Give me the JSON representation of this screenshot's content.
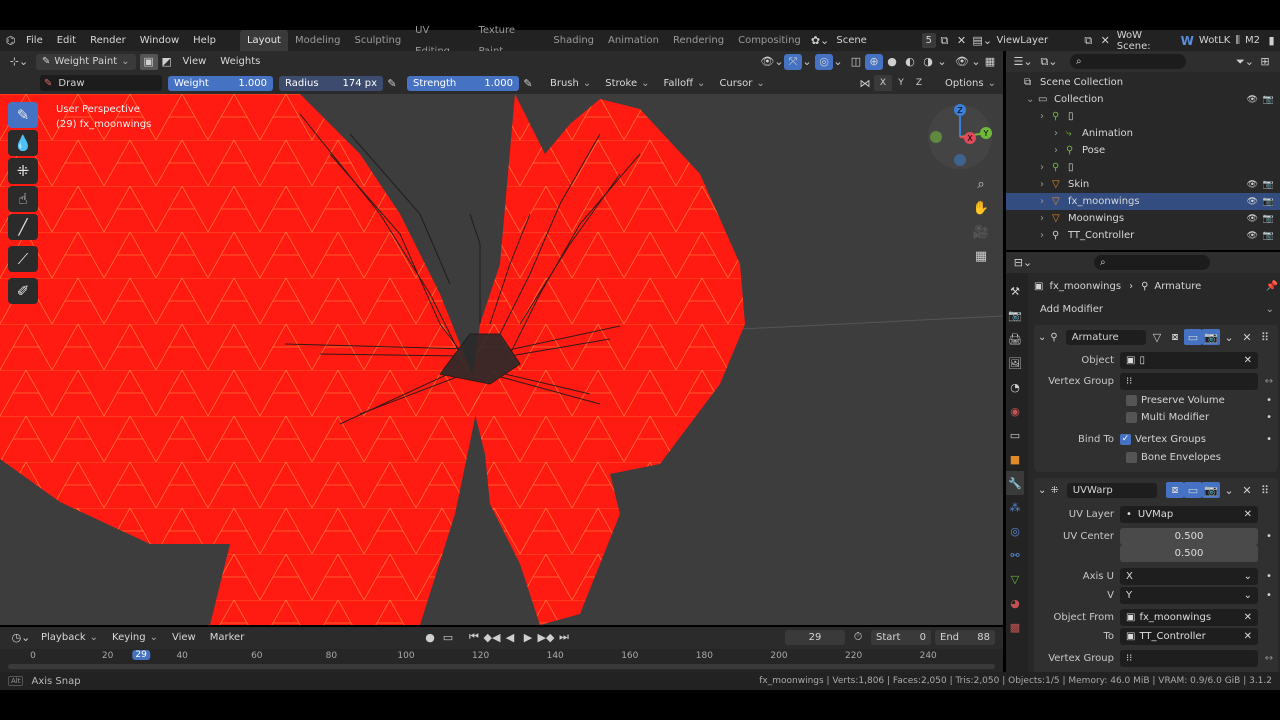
{
  "menu": [
    "File",
    "Edit",
    "Render",
    "Window",
    "Help"
  ],
  "workspaces": [
    "Layout",
    "Modeling",
    "Sculpting",
    "UV Editing",
    "Texture Paint",
    "Shading",
    "Animation",
    "Rendering",
    "Compositing"
  ],
  "scene": {
    "label": "Scene",
    "number": "5"
  },
  "view_layer": "ViewLayer",
  "wow_scene": {
    "label": "WoW Scene:",
    "expansion": "WotLK",
    "model": "M2"
  },
  "viewport_header": {
    "mode": "Weight Paint",
    "view": "View",
    "weights": "Weights",
    "options": "Options"
  },
  "tool_settings": {
    "brush_name": "Draw",
    "weight_label": "Weight",
    "weight_value": "1.000",
    "radius_label": "Radius",
    "radius_value": "174 px",
    "strength_label": "Strength",
    "strength_value": "1.000",
    "brush": "Brush",
    "stroke": "Stroke",
    "falloff": "Falloff",
    "cursor": "Cursor",
    "axes": [
      "X",
      "Y",
      "Z"
    ]
  },
  "viewport_overlay": {
    "perspective": "User Perspective",
    "object": "(29) fx_moonwings"
  },
  "gizmo": {
    "z": "Z",
    "y": "Y",
    "x": "X"
  },
  "outliner": {
    "rows": [
      {
        "label": "Scene Collection",
        "indent": 0
      },
      {
        "label": "Collection",
        "indent": 1
      },
      {
        "label": "▯",
        "indent": 2
      },
      {
        "label": "Animation",
        "indent": 3
      },
      {
        "label": "Pose",
        "indent": 3
      },
      {
        "label": "▯",
        "indent": 2
      },
      {
        "label": "Skin",
        "indent": 2
      },
      {
        "label": "fx_moonwings",
        "indent": 2,
        "selected": true
      },
      {
        "label": "Moonwings",
        "indent": 2
      },
      {
        "label": "TT_Controller",
        "indent": 2
      }
    ]
  },
  "properties": {
    "breadcrumb_object": "fx_moonwings",
    "breadcrumb_modifier": "Armature",
    "add_modifier": "Add Modifier",
    "armature": {
      "name": "Armature",
      "object_label": "Object",
      "object_value": "▯",
      "vertex_group_label": "Vertex Group",
      "preserve_volume": "Preserve Volume",
      "multi_modifier": "Multi Modifier",
      "bind_to_label": "Bind To",
      "vertex_groups": "Vertex Groups",
      "bone_envelopes": "Bone Envelopes"
    },
    "uvwarp": {
      "name": "UVWarp",
      "uv_layer_label": "UV Layer",
      "uv_layer_value": "UVMap",
      "uv_center_label": "UV Center",
      "uv_center_x": "0.500",
      "uv_center_y": "0.500",
      "axis_u_label": "Axis U",
      "axis_u_value": "X",
      "v_label": "V",
      "v_value": "Y",
      "object_from_label": "Object From",
      "object_from_value": "fx_moonwings",
      "to_label": "To",
      "to_value": "TT_Controller",
      "vertex_group_label": "Vertex Group"
    }
  },
  "timeline": {
    "playback": "Playback",
    "keying": "Keying",
    "view": "View",
    "marker": "Marker",
    "current_frame": "29",
    "start_label": "Start",
    "start": "0",
    "end_label": "End",
    "end": "88",
    "ticks": [
      "0",
      "20",
      "40",
      "60",
      "80",
      "100",
      "120",
      "140",
      "160",
      "180",
      "200",
      "220",
      "240"
    ],
    "playhead": "29"
  },
  "status": {
    "left": "Axis Snap",
    "key": "Alt",
    "right": "fx_moonwings | Verts:1,806 | Faces:2,050 | Tris:2,050 | Objects:1/5 | Memory: 46.0 MiB | VRAM: 0.9/6.0 GiB | 3.1.2"
  },
  "colors": {
    "accent": "#4672c4",
    "mesh": "#ff1a12",
    "wire": "#ff7a2a",
    "viewport_bg": "#3d3d3d"
  }
}
